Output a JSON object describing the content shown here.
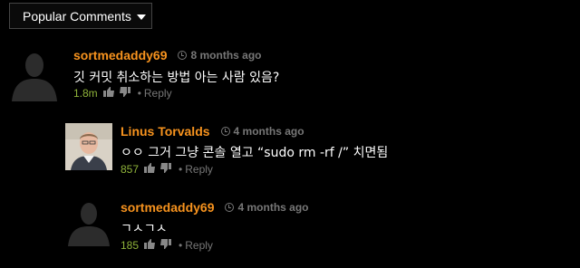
{
  "sort": {
    "label": "Popular Comments"
  },
  "comments": [
    {
      "author": "sortmedaddy69",
      "time": "8 months ago",
      "text": "깃 커밋 취소하는 방법 아는 사람 있음?",
      "votes": "1.8m",
      "dot": "•",
      "reply": "Reply"
    },
    {
      "author": "Linus Torvalds",
      "time": "4 months ago",
      "text": "ㅇㅇ 그거 그냥 콘솔 열고 “sudo rm -rf /” 치면됨",
      "votes": "857",
      "dot": "•",
      "reply": "Reply"
    },
    {
      "author": "sortmedaddy69",
      "time": "4 months ago",
      "text": "ㄱㅅㄱㅅ",
      "votes": "185",
      "dot": "•",
      "reply": "Reply"
    }
  ],
  "colors": {
    "author": "#f7931e",
    "votes": "#8fb33a",
    "muted": "#777777",
    "background": "#000000"
  }
}
